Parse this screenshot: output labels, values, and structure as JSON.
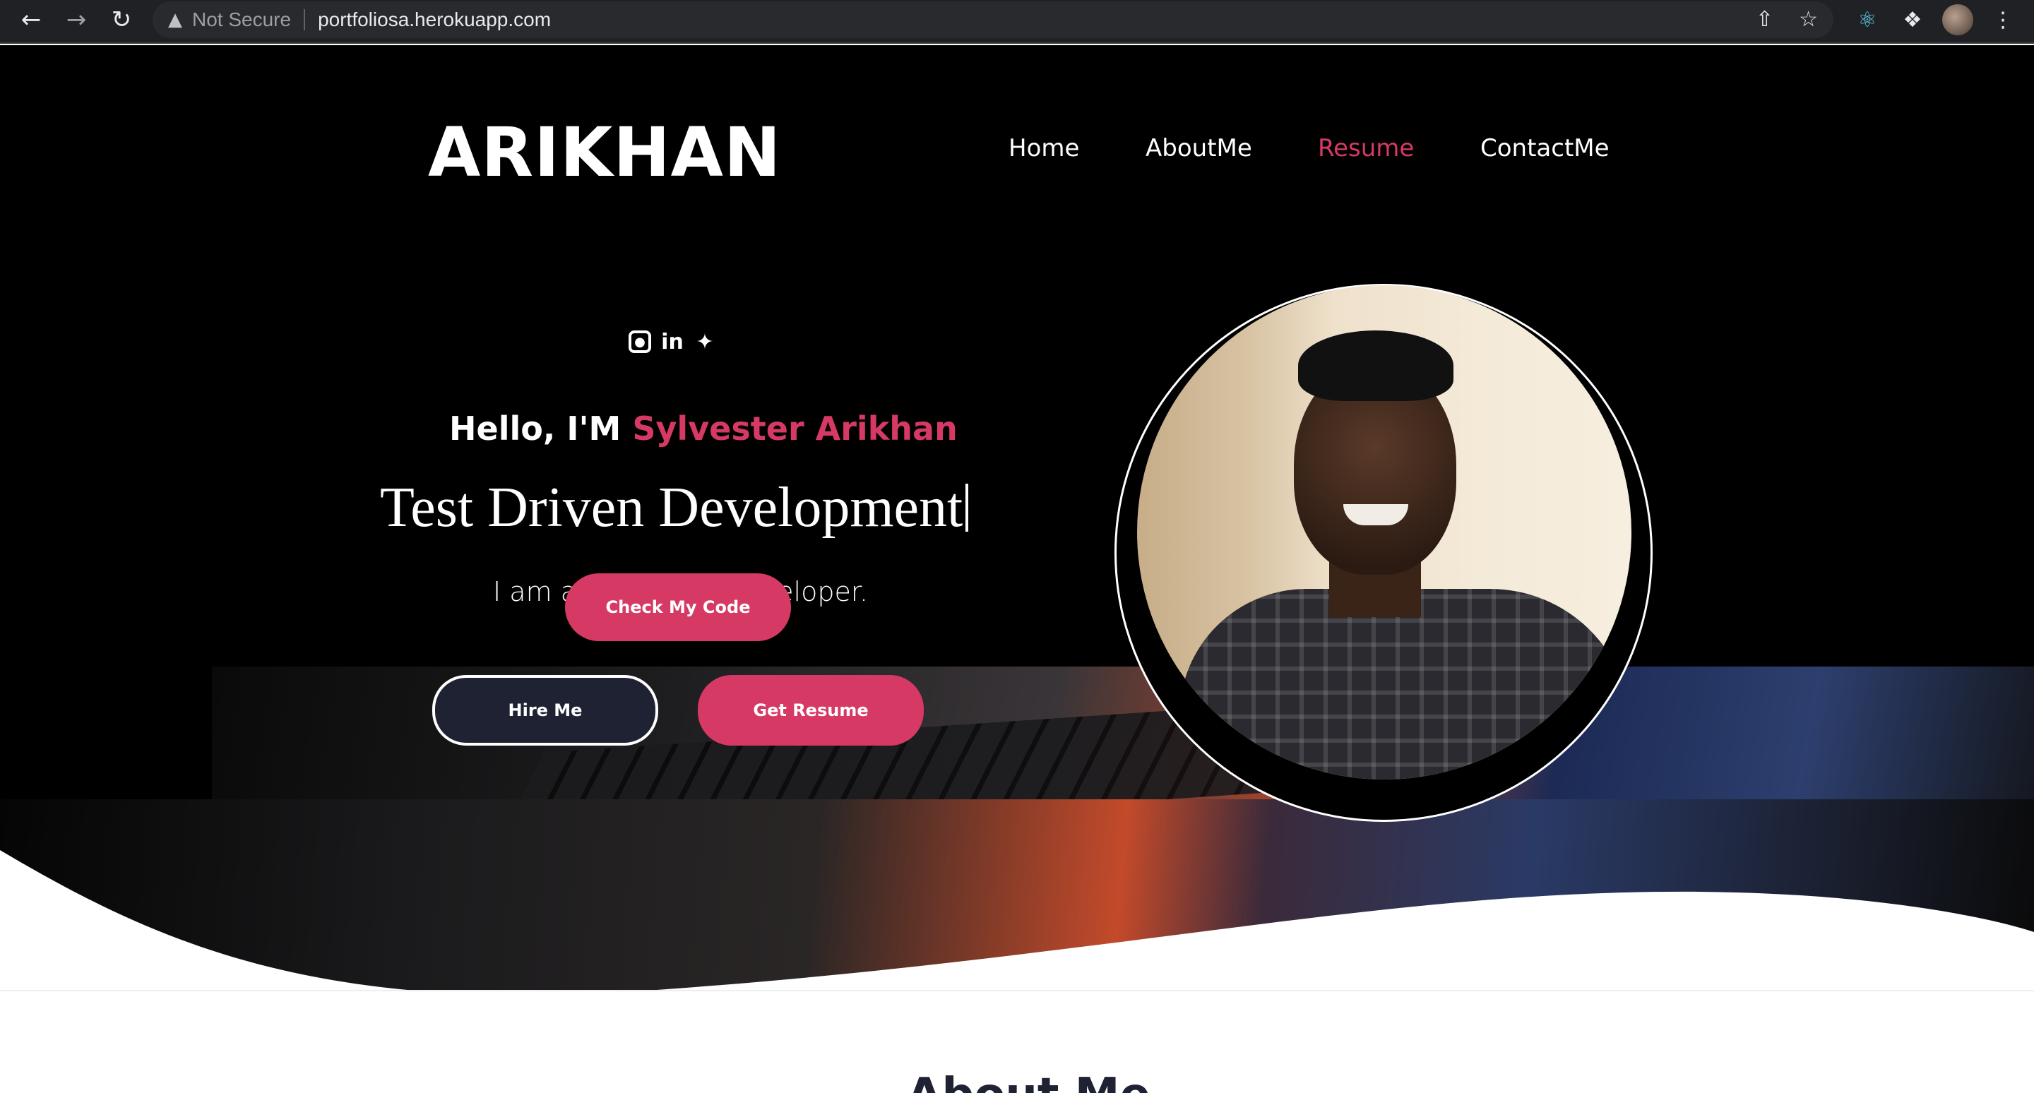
{
  "browser": {
    "security_label": "Not Secure",
    "url": "portfoliosa.herokuapp.com",
    "icons": [
      "back-icon",
      "forward-icon",
      "reload-icon",
      "warning-icon",
      "share-icon",
      "star-icon",
      "react-extension-icon",
      "extensions-icon",
      "profile-avatar",
      "menu-icon"
    ]
  },
  "header": {
    "brand": "ARIKHAN",
    "nav": [
      {
        "label": "Home",
        "active": false
      },
      {
        "label": "AboutMe",
        "active": false
      },
      {
        "label": "Resume",
        "active": true
      },
      {
        "label": "ContactMe",
        "active": false
      }
    ]
  },
  "hero": {
    "socials": [
      "github-icon",
      "linkedin-icon",
      "twitter-icon"
    ],
    "greeting": "Hello, I'M ",
    "name": "Sylvester Arikhan",
    "tagline": "Test Driven Development",
    "subtitle": "I am a Full-Stack Developer.",
    "buttons": {
      "check_code": "Check My Code",
      "hire_me": "Hire Me",
      "get_resume": "Get Resume"
    }
  },
  "about": {
    "heading": "About Me"
  },
  "colors": {
    "accent": "#d63a64",
    "dark_button": "#1f2233",
    "background": "#000000"
  }
}
